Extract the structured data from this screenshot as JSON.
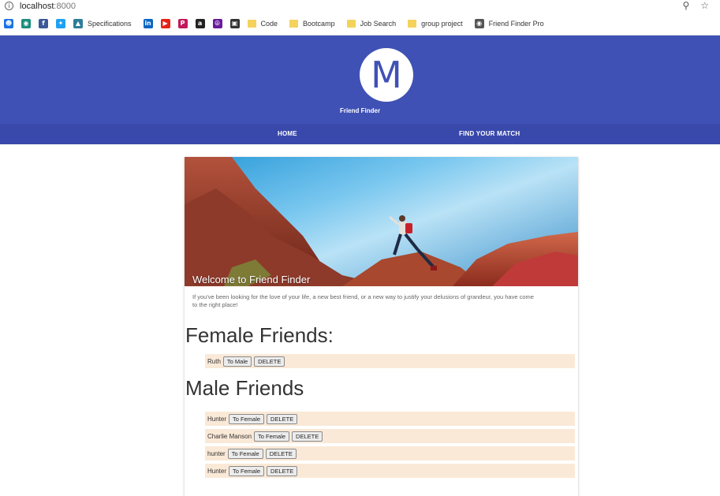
{
  "browser": {
    "url_host": "localhost",
    "url_port": ":8000",
    "bookmarks": [
      {
        "label": "",
        "icon": "contacts-icon",
        "color": "#1a73e8"
      },
      {
        "label": "",
        "icon": "maps-pin-icon",
        "color": "#1e8e7e"
      },
      {
        "label": "",
        "icon": "facebook-icon",
        "color": "#3b5998"
      },
      {
        "label": "",
        "icon": "twitter-icon",
        "color": "#1da1f2"
      },
      {
        "label": "Specifications",
        "icon": "specifications-icon",
        "color": "#2d7d9a"
      },
      {
        "label": "",
        "icon": "linkedin-icon",
        "color": "#0a66c2"
      },
      {
        "label": "",
        "icon": "youtube-icon",
        "color": "#e62117"
      },
      {
        "label": "",
        "icon": "pocket-icon",
        "color": "#c2185b"
      },
      {
        "label": "",
        "icon": "amazon-icon",
        "color": "#222222"
      },
      {
        "label": "",
        "icon": "peace-icon",
        "color": "#6a1b9a"
      },
      {
        "label": "",
        "icon": "suitcase-icon",
        "color": "#333333"
      },
      {
        "label": "Code",
        "icon": "folder-icon",
        "color": "#f4d25e"
      },
      {
        "label": "Bootcamp",
        "icon": "folder-icon",
        "color": "#f4d25e"
      },
      {
        "label": "Job Search",
        "icon": "folder-icon",
        "color": "#f4d25e"
      },
      {
        "label": "group project",
        "icon": "folder-icon",
        "color": "#f4d25e"
      },
      {
        "label": "Friend Finder Pro",
        "icon": "globe-icon",
        "color": "#555555"
      }
    ]
  },
  "header": {
    "logo_letter": "M",
    "brand": "Friend Finder",
    "nav": [
      "HOME",
      "FIND YOUR MATCH"
    ],
    "accent": "#3f51b5"
  },
  "card": {
    "hero_title": "Welcome to Friend Finder",
    "intro": "If you've been looking for the love of your life, a new best friend, or a new way to justify your delusions of grandeur, you have come to the right place!",
    "female_title": "Female Friends:",
    "male_title": "Male Friends",
    "female": [
      {
        "name": "Ruth",
        "swap": "To Male",
        "delete": "DELETE"
      }
    ],
    "male": [
      {
        "name": "Hunter",
        "swap": "To Female",
        "delete": "DELETE"
      },
      {
        "name": "Charlie Manson",
        "swap": "To Female",
        "delete": "DELETE"
      },
      {
        "name": "hunter",
        "swap": "To Female",
        "delete": "DELETE"
      },
      {
        "name": "Hunter",
        "swap": "To Female",
        "delete": "DELETE"
      }
    ],
    "row_color": "#fae9d7"
  }
}
